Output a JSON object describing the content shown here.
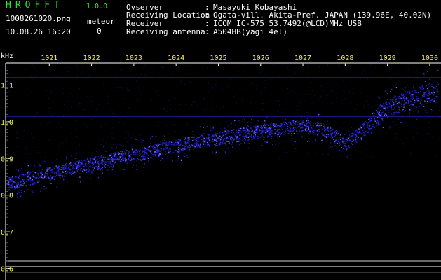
{
  "app": {
    "title": "HROFFT",
    "version": "1.0.0"
  },
  "file": {
    "name": "1008261020.png",
    "datetime": "10.08.26 16:20"
  },
  "meteor": {
    "label": "meteor",
    "count": "0"
  },
  "info": {
    "rows": [
      {
        "label": "Ovserver",
        "value": "Masayuki Kobayashi"
      },
      {
        "label": "Receiving Location",
        "value": "Ogata-vill. Akita-Pref. JAPAN (139.96E, 40.02N)"
      },
      {
        "label": "Receiver",
        "value": "ICOM IC-575 53.7492(@LCD)MHz USB"
      },
      {
        "label": "Receiving antenna",
        "value": "A504HB(yagi 4el)"
      }
    ]
  },
  "chart_data": {
    "type": "scatter",
    "ylabel": "kHz",
    "x_tick_labels": [
      "1021",
      "1022",
      "1023",
      "1024",
      "1025",
      "1026",
      "1027",
      "1028",
      "1029",
      "1030"
    ],
    "y_tick_labels": [
      "1.1",
      "1.0",
      "0.9",
      "0.8",
      "0.7",
      "0.6"
    ],
    "ylim": [
      0.58,
      1.16
    ],
    "reference_lines_khz": [
      1.12,
      1.015
    ],
    "bottom_lines_khz": [
      0.62,
      0.605,
      0.59
    ],
    "trace": {
      "description_points": [
        {
          "x": 1020.0,
          "y": 0.83
        },
        {
          "x": 1021.0,
          "y": 0.86
        },
        {
          "x": 1022.0,
          "y": 0.885
        },
        {
          "x": 1023.0,
          "y": 0.91
        },
        {
          "x": 1024.0,
          "y": 0.935
        },
        {
          "x": 1025.0,
          "y": 0.955
        },
        {
          "x": 1026.0,
          "y": 0.975
        },
        {
          "x": 1027.0,
          "y": 0.99
        },
        {
          "x": 1027.6,
          "y": 0.975
        },
        {
          "x": 1028.0,
          "y": 0.94
        },
        {
          "x": 1028.5,
          "y": 0.985
        },
        {
          "x": 1029.0,
          "y": 1.04
        },
        {
          "x": 1030.0,
          "y": 1.08
        }
      ]
    },
    "colors": {
      "trace": "#2a2aff",
      "reference": "#3030ff",
      "tick_text": "#f4f44a",
      "axis": "#ffffff"
    },
    "grid": false
  }
}
